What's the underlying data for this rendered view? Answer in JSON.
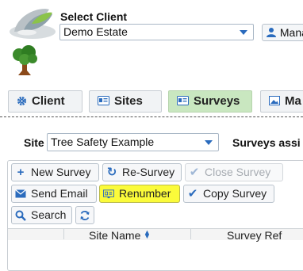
{
  "header": {
    "select_client_label": "Select Client",
    "client_value": "Demo Estate",
    "manage_label": "Mana"
  },
  "tabs": [
    {
      "label": "Client",
      "icon": "gear-icon",
      "active": false
    },
    {
      "label": "Sites",
      "icon": "id-card-icon",
      "active": false
    },
    {
      "label": "Surveys",
      "icon": "id-card-icon",
      "active": true
    },
    {
      "label": "Ma",
      "icon": "image-icon",
      "active": false
    }
  ],
  "site": {
    "label": "Site",
    "value": "Tree Safety Example",
    "assigned_label": "Surveys assi"
  },
  "toolbar": {
    "new_survey": "New Survey",
    "re_survey": "Re-Survey",
    "close_survey": "Close Survey",
    "send_email": "Send Email",
    "renumber": "Renumber",
    "copy_survey": "Copy Survey",
    "search": "Search"
  },
  "table": {
    "columns": [
      "Site Name",
      "Survey Ref"
    ]
  },
  "colors": {
    "accent": "#2a6bbd",
    "active_tab": "#c9e7c0",
    "highlight": "#fbfb3a"
  }
}
